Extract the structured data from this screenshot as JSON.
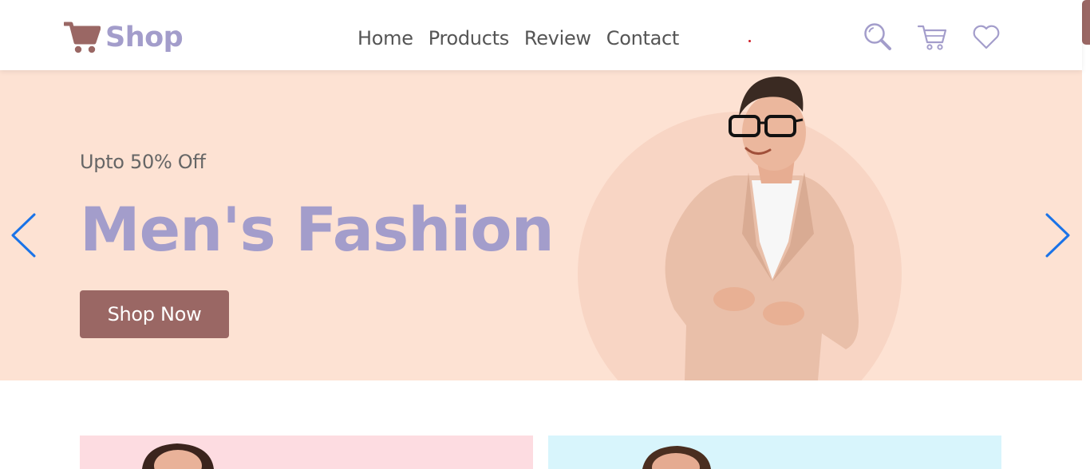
{
  "brand": {
    "name": "Shop",
    "icon": "cart-icon",
    "color": "#a39dcb",
    "icon_color": "#9a6764"
  },
  "nav": {
    "items": [
      {
        "label": "Home"
      },
      {
        "label": "Products"
      },
      {
        "label": "Review"
      },
      {
        "label": "Contact"
      }
    ]
  },
  "header_icons": [
    {
      "name": "search-icon"
    },
    {
      "name": "cart-icon"
    },
    {
      "name": "heart-icon"
    }
  ],
  "hero": {
    "subtitle": "Upto 50% Off",
    "title": "Men's Fashion",
    "cta_label": "Shop Now",
    "background": "#fde2d3",
    "title_color": "#a39dcb",
    "cta_color": "#9a6764",
    "arrow_color": "#1a73e8"
  },
  "cards": [
    {
      "name": "product-card-women",
      "background": "#fddce1"
    },
    {
      "name": "product-card-men",
      "background": "#d8f5fc"
    }
  ]
}
